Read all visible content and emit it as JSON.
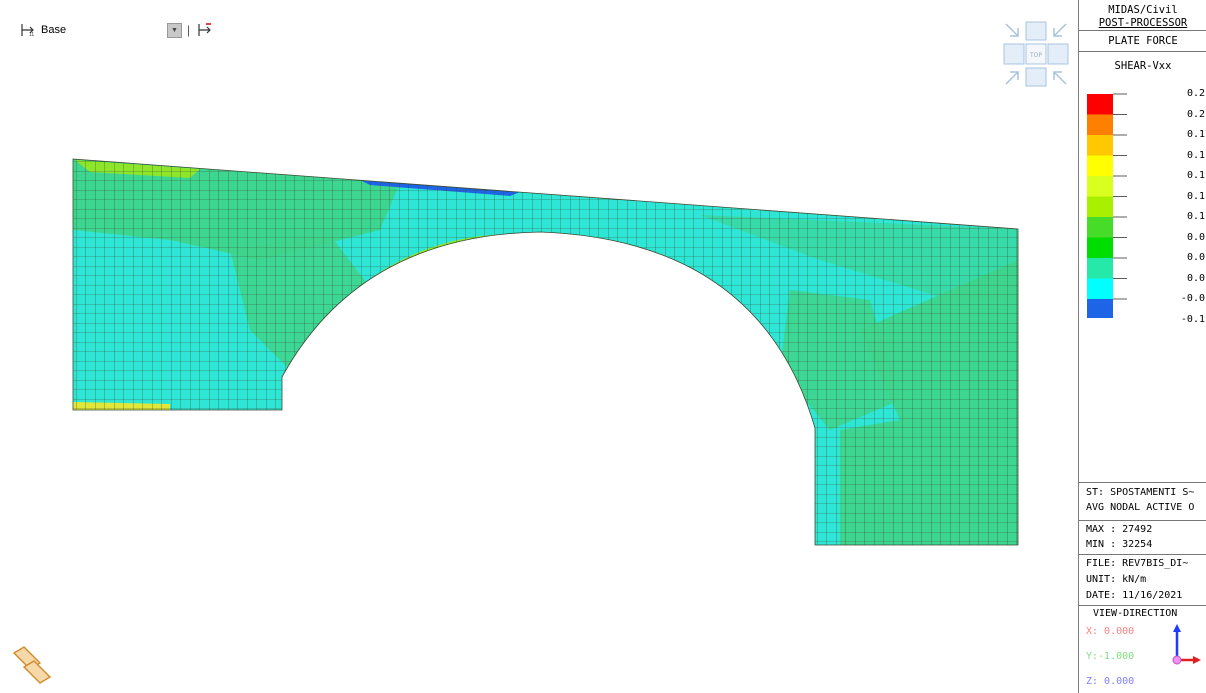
{
  "toolbar": {
    "layer_icon": "story-level-icon",
    "layer_label": "Base",
    "dropdown_icon": "chevron-down-icon",
    "next_icon": "story-level-arrow-icon"
  },
  "view_cube": {
    "top_label": "TOP"
  },
  "legend": {
    "title1": "MIDAS/Civil",
    "title2": "POST-PROCESSOR",
    "result_type": "PLATE FORCE",
    "component": "SHEAR-Vxx",
    "levels": [
      "0.2",
      "0.2",
      "0.1",
      "0.1",
      "0.1",
      "0.1",
      "0.1",
      "0.0",
      "0.0",
      "0.0",
      "-0.0",
      "-0.1"
    ],
    "colors": [
      "#ff0000",
      "#ff7f00",
      "#ffc800",
      "#ffff00",
      "#d8ff1e",
      "#a8f000",
      "#46dc28",
      "#00dd00",
      "#26e8a8",
      "#00ffff",
      "#1e64e6"
    ],
    "st_line": "ST: SPOSTAMENTI S~",
    "avg_line": "AVG NODAL ACTIVE O",
    "max": "MAX : 27492",
    "min": "MIN : 32254",
    "file": "FILE: REV7BIS_DI~",
    "unit": "UNIT: kN/m",
    "date": "DATE: 11/16/2021",
    "view_direction": "VIEW-DIRECTION",
    "x": "X: 0.000",
    "y": "Y:-1.000",
    "z": "Z: 0.000",
    "x_color": "#ff7f7f",
    "y_color": "#7fdf7f",
    "z_color": "#7f7fff"
  },
  "colors": {
    "mesh_base": "#2ee6d6",
    "mesh_green": "#3ed48a",
    "mesh_lime": "#8ee62a",
    "mesh_yellow": "#dfe838",
    "mesh_blue": "#1e64e6",
    "mesh_line": "#3a4a30"
  }
}
